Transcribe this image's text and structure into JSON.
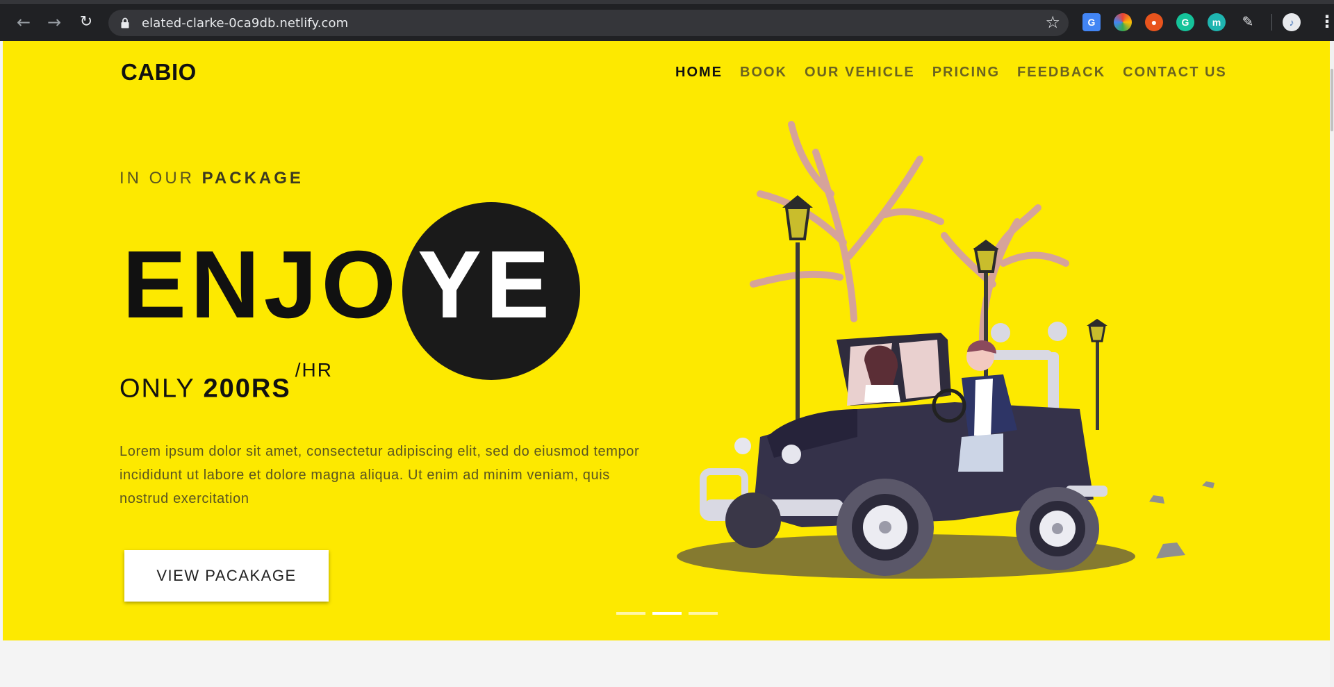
{
  "browser": {
    "url": "elated-clarke-0ca9db.netlify.com",
    "icons": [
      "back-icon",
      "forward-icon",
      "reload-icon",
      "lock-icon",
      "star-icon",
      "google-translate-icon",
      "colorpicker-extension-icon",
      "extension-icon",
      "grammarly-icon",
      "extension-m-icon",
      "pen-icon",
      "profile-avatar",
      "menu-icon"
    ],
    "ext_m_label": "m"
  },
  "header": {
    "brand": "CABIO",
    "nav": [
      "HOME",
      "BOOK",
      "OUR VEHICLE",
      "PRICING",
      "FEEDBACK",
      "CONTACT US"
    ],
    "active": "HOME"
  },
  "hero": {
    "eyebrow_prefix": "IN OUR ",
    "eyebrow_strong": "PACKAGE",
    "headline_left": "ENJO",
    "headline_circle": "YE",
    "price_prefix": "ONLY ",
    "price_value": "200RS",
    "price_unit": "/HR",
    "body": "Lorem ipsum dolor sit amet, consectetur adipiscing elit, sed do eiusmod tempor incididunt ut labore et dolore magna aliqua. Ut enim ad minim veniam, quis nostrud exercitation",
    "button": "VIEW PACAKAGE",
    "slides": 3,
    "active_slide": 2
  },
  "colors": {
    "hero_bg": "#fde900",
    "text_dark": "#111111",
    "muted": "#6b6320",
    "chrome_bg": "#202124"
  }
}
